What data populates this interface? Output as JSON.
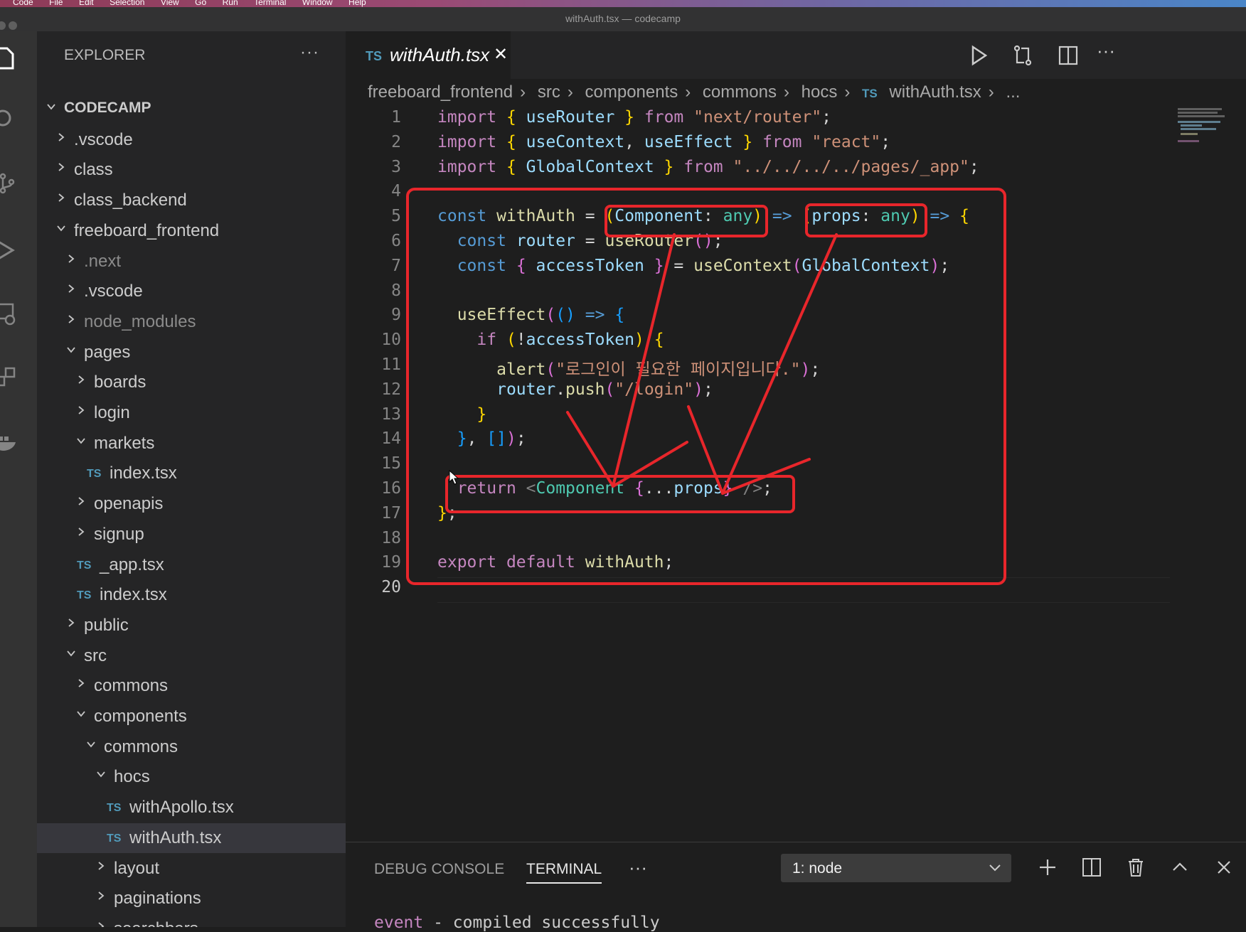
{
  "menubar": {
    "items": [
      "Code",
      "File",
      "Edit",
      "Selection",
      "View",
      "Go",
      "Run",
      "Terminal",
      "Window",
      "Help"
    ]
  },
  "window": {
    "title": "withAuth.tsx — codecamp"
  },
  "explorer": {
    "header": "EXPLORER",
    "root": "CODECAMP",
    "items": [
      {
        "label": ".vscode",
        "type": "folder",
        "expanded": false,
        "depth": 1
      },
      {
        "label": "class",
        "type": "folder",
        "expanded": false,
        "depth": 1
      },
      {
        "label": "class_backend",
        "type": "folder",
        "expanded": false,
        "depth": 1
      },
      {
        "label": "freeboard_frontend",
        "type": "folder",
        "expanded": true,
        "depth": 1
      },
      {
        "label": ".next",
        "type": "folder",
        "expanded": false,
        "depth": 2,
        "dim": true
      },
      {
        "label": ".vscode",
        "type": "folder",
        "expanded": false,
        "depth": 2
      },
      {
        "label": "node_modules",
        "type": "folder",
        "expanded": false,
        "depth": 2,
        "dim": true
      },
      {
        "label": "pages",
        "type": "folder",
        "expanded": true,
        "depth": 2
      },
      {
        "label": "boards",
        "type": "folder",
        "expanded": false,
        "depth": 3
      },
      {
        "label": "login",
        "type": "folder",
        "expanded": false,
        "depth": 3
      },
      {
        "label": "markets",
        "type": "folder",
        "expanded": true,
        "depth": 3
      },
      {
        "label": "index.tsx",
        "type": "file",
        "depth": 4
      },
      {
        "label": "openapis",
        "type": "folder",
        "expanded": false,
        "depth": 3
      },
      {
        "label": "signup",
        "type": "folder",
        "expanded": false,
        "depth": 3
      },
      {
        "label": "_app.tsx",
        "type": "file",
        "depth": 3
      },
      {
        "label": "index.tsx",
        "type": "file",
        "depth": 3
      },
      {
        "label": "public",
        "type": "folder",
        "expanded": false,
        "depth": 2
      },
      {
        "label": "src",
        "type": "folder",
        "expanded": true,
        "depth": 2
      },
      {
        "label": "commons",
        "type": "folder",
        "expanded": false,
        "depth": 3
      },
      {
        "label": "components",
        "type": "folder",
        "expanded": true,
        "depth": 3
      },
      {
        "label": "commons",
        "type": "folder",
        "expanded": true,
        "depth": 4
      },
      {
        "label": "hocs",
        "type": "folder",
        "expanded": true,
        "depth": 5
      },
      {
        "label": "withApollo.tsx",
        "type": "file",
        "depth": 6
      },
      {
        "label": "withAuth.tsx",
        "type": "file",
        "depth": 6,
        "selected": true
      },
      {
        "label": "layout",
        "type": "folder",
        "expanded": false,
        "depth": 5
      },
      {
        "label": "paginations",
        "type": "folder",
        "expanded": false,
        "depth": 5
      },
      {
        "label": "searchbars",
        "type": "folder",
        "expanded": false,
        "depth": 5
      }
    ]
  },
  "editor": {
    "tab": {
      "badge": "TS",
      "name": "withAuth.tsx"
    },
    "breadcrumb": [
      "freeboard_frontend",
      "src",
      "components",
      "commons",
      "hocs",
      "withAuth.tsx",
      "..."
    ],
    "breadcrumb_badge": "TS",
    "current_line": 20,
    "lines": [
      [
        [
          "kwc",
          "import"
        ],
        [
          "pu",
          " "
        ],
        [
          "br1",
          "{"
        ],
        [
          "pu",
          " "
        ],
        [
          "va",
          "useRouter"
        ],
        [
          "pu",
          " "
        ],
        [
          "br1",
          "}"
        ],
        [
          "pu",
          " "
        ],
        [
          "kwc",
          "from"
        ],
        [
          "pu",
          " "
        ],
        [
          "str",
          "\"next/router\""
        ],
        [
          "pu",
          ";"
        ]
      ],
      [
        [
          "kwc",
          "import"
        ],
        [
          "pu",
          " "
        ],
        [
          "br1",
          "{"
        ],
        [
          "pu",
          " "
        ],
        [
          "va",
          "useContext"
        ],
        [
          "pu",
          ", "
        ],
        [
          "va",
          "useEffect"
        ],
        [
          "pu",
          " "
        ],
        [
          "br1",
          "}"
        ],
        [
          "pu",
          " "
        ],
        [
          "kwc",
          "from"
        ],
        [
          "pu",
          " "
        ],
        [
          "str",
          "\"react\""
        ],
        [
          "pu",
          ";"
        ]
      ],
      [
        [
          "kwc",
          "import"
        ],
        [
          "pu",
          " "
        ],
        [
          "br1",
          "{"
        ],
        [
          "pu",
          " "
        ],
        [
          "va",
          "GlobalContext"
        ],
        [
          "pu",
          " "
        ],
        [
          "br1",
          "}"
        ],
        [
          "pu",
          " "
        ],
        [
          "kwc",
          "from"
        ],
        [
          "pu",
          " "
        ],
        [
          "str",
          "\"../../../../pages/_app\""
        ],
        [
          "pu",
          ";"
        ]
      ],
      [],
      [
        [
          "kw",
          "const"
        ],
        [
          "pu",
          " "
        ],
        [
          "fn",
          "withAuth"
        ],
        [
          "pu",
          " = "
        ],
        [
          "br1",
          "("
        ],
        [
          "va",
          "Component"
        ],
        [
          "pu",
          ": "
        ],
        [
          "ty",
          "any"
        ],
        [
          "br1",
          ")"
        ],
        [
          "pu",
          " "
        ],
        [
          "kw",
          "=>"
        ],
        [
          "pu",
          " "
        ],
        [
          "br1",
          "("
        ],
        [
          "va",
          "props"
        ],
        [
          "pu",
          ": "
        ],
        [
          "ty",
          "any"
        ],
        [
          "br1",
          ")"
        ],
        [
          "pu",
          " "
        ],
        [
          "kw",
          "=>"
        ],
        [
          "pu",
          " "
        ],
        [
          "br1",
          "{"
        ]
      ],
      [
        [
          "pu",
          "  "
        ],
        [
          "kw",
          "const"
        ],
        [
          "pu",
          " "
        ],
        [
          "va",
          "router"
        ],
        [
          "pu",
          " = "
        ],
        [
          "fn",
          "useRouter"
        ],
        [
          "br2",
          "()"
        ],
        [
          "pu",
          ";"
        ]
      ],
      [
        [
          "pu",
          "  "
        ],
        [
          "kw",
          "const"
        ],
        [
          "pu",
          " "
        ],
        [
          "br2",
          "{"
        ],
        [
          "pu",
          " "
        ],
        [
          "va",
          "accessToken"
        ],
        [
          "pu",
          " "
        ],
        [
          "br2",
          "}"
        ],
        [
          "pu",
          " = "
        ],
        [
          "fn",
          "useContext"
        ],
        [
          "br2",
          "("
        ],
        [
          "va",
          "GlobalContext"
        ],
        [
          "br2",
          ")"
        ],
        [
          "pu",
          ";"
        ]
      ],
      [],
      [
        [
          "pu",
          "  "
        ],
        [
          "fn",
          "useEffect"
        ],
        [
          "br2",
          "("
        ],
        [
          "br3",
          "()"
        ],
        [
          "pu",
          " "
        ],
        [
          "kw",
          "=>"
        ],
        [
          "pu",
          " "
        ],
        [
          "br3",
          "{"
        ]
      ],
      [
        [
          "pu",
          "    "
        ],
        [
          "kwc",
          "if"
        ],
        [
          "pu",
          " "
        ],
        [
          "br1",
          "("
        ],
        [
          "pu",
          "!"
        ],
        [
          "va",
          "accessToken"
        ],
        [
          "br1",
          ")"
        ],
        [
          "pu",
          " "
        ],
        [
          "br1",
          "{"
        ]
      ],
      [
        [
          "pu",
          "      "
        ],
        [
          "fn",
          "alert"
        ],
        [
          "br2",
          "("
        ],
        [
          "str",
          "\"로그인이 필요한 페이지입니다.\""
        ],
        [
          "br2",
          ")"
        ],
        [
          "pu",
          ";"
        ]
      ],
      [
        [
          "pu",
          "      "
        ],
        [
          "va",
          "router"
        ],
        [
          "pu",
          "."
        ],
        [
          "fn",
          "push"
        ],
        [
          "br2",
          "("
        ],
        [
          "str",
          "\"/login\""
        ],
        [
          "br2",
          ")"
        ],
        [
          "pu",
          ";"
        ]
      ],
      [
        [
          "pu",
          "    "
        ],
        [
          "br1",
          "}"
        ]
      ],
      [
        [
          "pu",
          "  "
        ],
        [
          "br3",
          "}"
        ],
        [
          "pu",
          ", "
        ],
        [
          "br3",
          "[]"
        ],
        [
          "br2",
          ")"
        ],
        [
          "pu",
          ";"
        ]
      ],
      [],
      [
        [
          "pu",
          "  "
        ],
        [
          "kwc",
          "return"
        ],
        [
          "pu",
          " "
        ],
        [
          "tg",
          "<"
        ],
        [
          "ty",
          "Component"
        ],
        [
          "pu",
          " "
        ],
        [
          "br2",
          "{"
        ],
        [
          "pu",
          "..."
        ],
        [
          "va",
          "props"
        ],
        [
          "br2",
          "}"
        ],
        [
          "pu",
          " "
        ],
        [
          "tg",
          "/>"
        ],
        [
          "pu",
          ";"
        ]
      ],
      [
        [
          "br1",
          "}"
        ],
        [
          "pu",
          ";"
        ]
      ],
      [],
      [
        [
          "kwc",
          "export"
        ],
        [
          "pu",
          " "
        ],
        [
          "kwc",
          "default"
        ],
        [
          "pu",
          " "
        ],
        [
          "fn",
          "withAuth"
        ],
        [
          "pu",
          ";"
        ]
      ],
      []
    ]
  },
  "panel": {
    "tabs": [
      "DEBUG CONSOLE",
      "TERMINAL"
    ],
    "active_tab": "TERMINAL",
    "more": "···",
    "terminal_select": "1: node",
    "terminal_output": {
      "label": "event",
      "message": " - compiled successfully"
    }
  },
  "annotation_color": "#e8262b"
}
